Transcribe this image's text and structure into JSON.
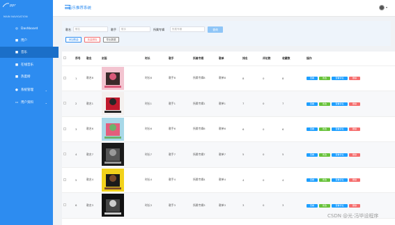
{
  "logo_text": "ppr",
  "nav_title": "MAIN NAVIGATION",
  "nav": [
    {
      "label": "Dashboard",
      "icon": "circle-icon",
      "glyph": "◎"
    },
    {
      "label": "用户",
      "icon": "square-icon",
      "glyph": "■"
    },
    {
      "label": "音乐",
      "icon": "square-icon",
      "glyph": "■"
    },
    {
      "label": "在线音乐",
      "icon": "square-icon",
      "glyph": "■"
    },
    {
      "label": "热度榜",
      "icon": "square-icon",
      "glyph": "■"
    },
    {
      "label": "系统管理",
      "icon": "pin-icon",
      "glyph": "●"
    },
    {
      "label": "用户资料",
      "icon": "id-card-icon",
      "glyph": "▭"
    }
  ],
  "header": {
    "title": "音乐推荐系统"
  },
  "search": {
    "song_label": "歌名",
    "song_placeholder": "歌名",
    "singer_label": "歌手",
    "singer_placeholder": "歌手",
    "album_label": "所属专辑",
    "album_placeholder": "所属专辑",
    "query_label": "查询",
    "add_label": "添加歌曲",
    "batch_delete_label": "批量删除",
    "export_label": "导出数据"
  },
  "table": {
    "headers": [
      "",
      "序号",
      "歌名",
      "封面",
      "时长",
      "歌手",
      "所属专辑",
      "歌单",
      "排名",
      "评论数",
      "收藏数",
      "操作"
    ],
    "rows": [
      {
        "no": "1",
        "name": "歌名8",
        "duration": "时长8",
        "singer": "歌手8",
        "album": "所属专辑8",
        "list": "歌单8",
        "rank": "8",
        "comments": "0",
        "favs": "8"
      },
      {
        "no": "2",
        "name": "歌名1",
        "duration": "时长1",
        "singer": "歌手1",
        "album": "所属专辑1",
        "list": "歌单1",
        "rank": "7",
        "comments": "0",
        "favs": "7"
      },
      {
        "no": "3",
        "name": "歌名6",
        "duration": "时长6",
        "singer": "歌手6",
        "album": "所属专辑6",
        "list": "歌单6",
        "rank": "6",
        "comments": "0",
        "favs": "6"
      },
      {
        "no": "4",
        "name": "歌名7",
        "duration": "时长7",
        "singer": "歌手7",
        "album": "所属专辑7",
        "list": "歌单7",
        "rank": "5",
        "comments": "0",
        "favs": "5"
      },
      {
        "no": "5",
        "name": "歌名4",
        "duration": "时长4",
        "singer": "歌手4",
        "album": "所属专辑4",
        "list": "歌单4",
        "rank": "4",
        "comments": "0",
        "favs": "4"
      },
      {
        "no": "6",
        "name": "歌名3",
        "duration": "时长3",
        "singer": "歌手3",
        "album": "所属专辑3",
        "list": "歌单3",
        "rank": "3",
        "comments": "0",
        "favs": "3"
      }
    ],
    "actions": {
      "view": "查看",
      "edit": "修改",
      "comments": "查看评论",
      "delete": "删除"
    }
  },
  "watermark": "CSDN @光·冯毕设程序",
  "colors": {
    "primary": "#2d8cf0",
    "edit": "#67c23a",
    "danger": "#f56c6c"
  }
}
